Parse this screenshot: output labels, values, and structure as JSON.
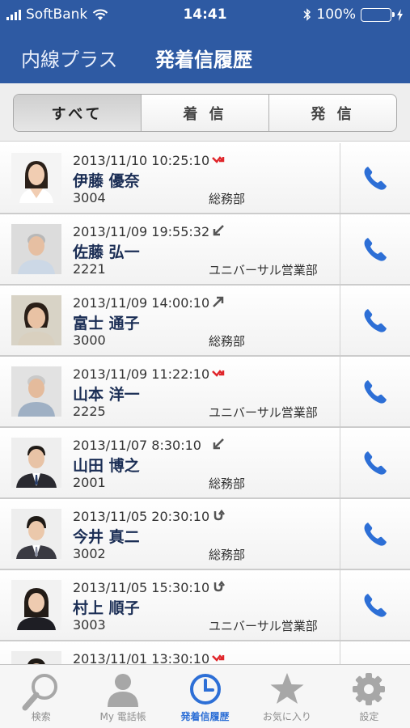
{
  "status_bar": {
    "carrier": "SoftBank",
    "time": "14:41",
    "battery": "100%"
  },
  "nav": {
    "app_name": "内線プラス",
    "title": "発着信履歴"
  },
  "segments": [
    {
      "label": "すべて",
      "selected": true
    },
    {
      "label": "着 信",
      "selected": false
    },
    {
      "label": "発 信",
      "selected": false
    }
  ],
  "history": [
    {
      "datetime": "2013/11/10 10:25:10",
      "direction_icon": "missed-call-icon",
      "name": "伊藤 優奈",
      "ext": "3004",
      "dept": "総務部"
    },
    {
      "datetime": "2013/11/09 19:55:32",
      "direction_icon": "incoming-call-icon",
      "name": "佐藤 弘一",
      "ext": "2221",
      "dept": "ユニバーサル営業部"
    },
    {
      "datetime": "2013/11/09 14:00:10",
      "direction_icon": "outgoing-call-icon",
      "name": "富士 通子",
      "ext": "3000",
      "dept": "総務部"
    },
    {
      "datetime": "2013/11/09 11:22:10",
      "direction_icon": "missed-call-icon",
      "name": "山本 洋一",
      "ext": "2225",
      "dept": "ユニバーサル営業部"
    },
    {
      "datetime": "2013/11/07 8:30:10",
      "direction_icon": "incoming-call-icon",
      "name": "山田 博之",
      "ext": "2001",
      "dept": "総務部"
    },
    {
      "datetime": "2013/11/05 20:30:10",
      "direction_icon": "transfer-call-icon",
      "name": "今井 真二",
      "ext": "3002",
      "dept": "総務部"
    },
    {
      "datetime": "2013/11/05 15:30:10",
      "direction_icon": "transfer-call-icon",
      "name": "村上 順子",
      "ext": "3003",
      "dept": "ユニバーサル営業部"
    },
    {
      "datetime": "2013/11/01 13:30:10",
      "direction_icon": "missed-call-icon",
      "name": "",
      "ext": "",
      "dept": ""
    }
  ],
  "tabs": [
    {
      "label": "検索",
      "icon": "search-icon",
      "active": false
    },
    {
      "label": "My 電話帳",
      "icon": "contact-person-icon",
      "active": false
    },
    {
      "label": "発着信履歴",
      "icon": "clock-icon",
      "active": true
    },
    {
      "label": "お気に入り",
      "icon": "star-icon",
      "active": false
    },
    {
      "label": "設定",
      "icon": "gear-icon",
      "active": false
    }
  ],
  "colors": {
    "header": "#2e5aa3",
    "accent": "#2d6fd6",
    "missed": "#e0262b",
    "battery": "#4cd964"
  }
}
